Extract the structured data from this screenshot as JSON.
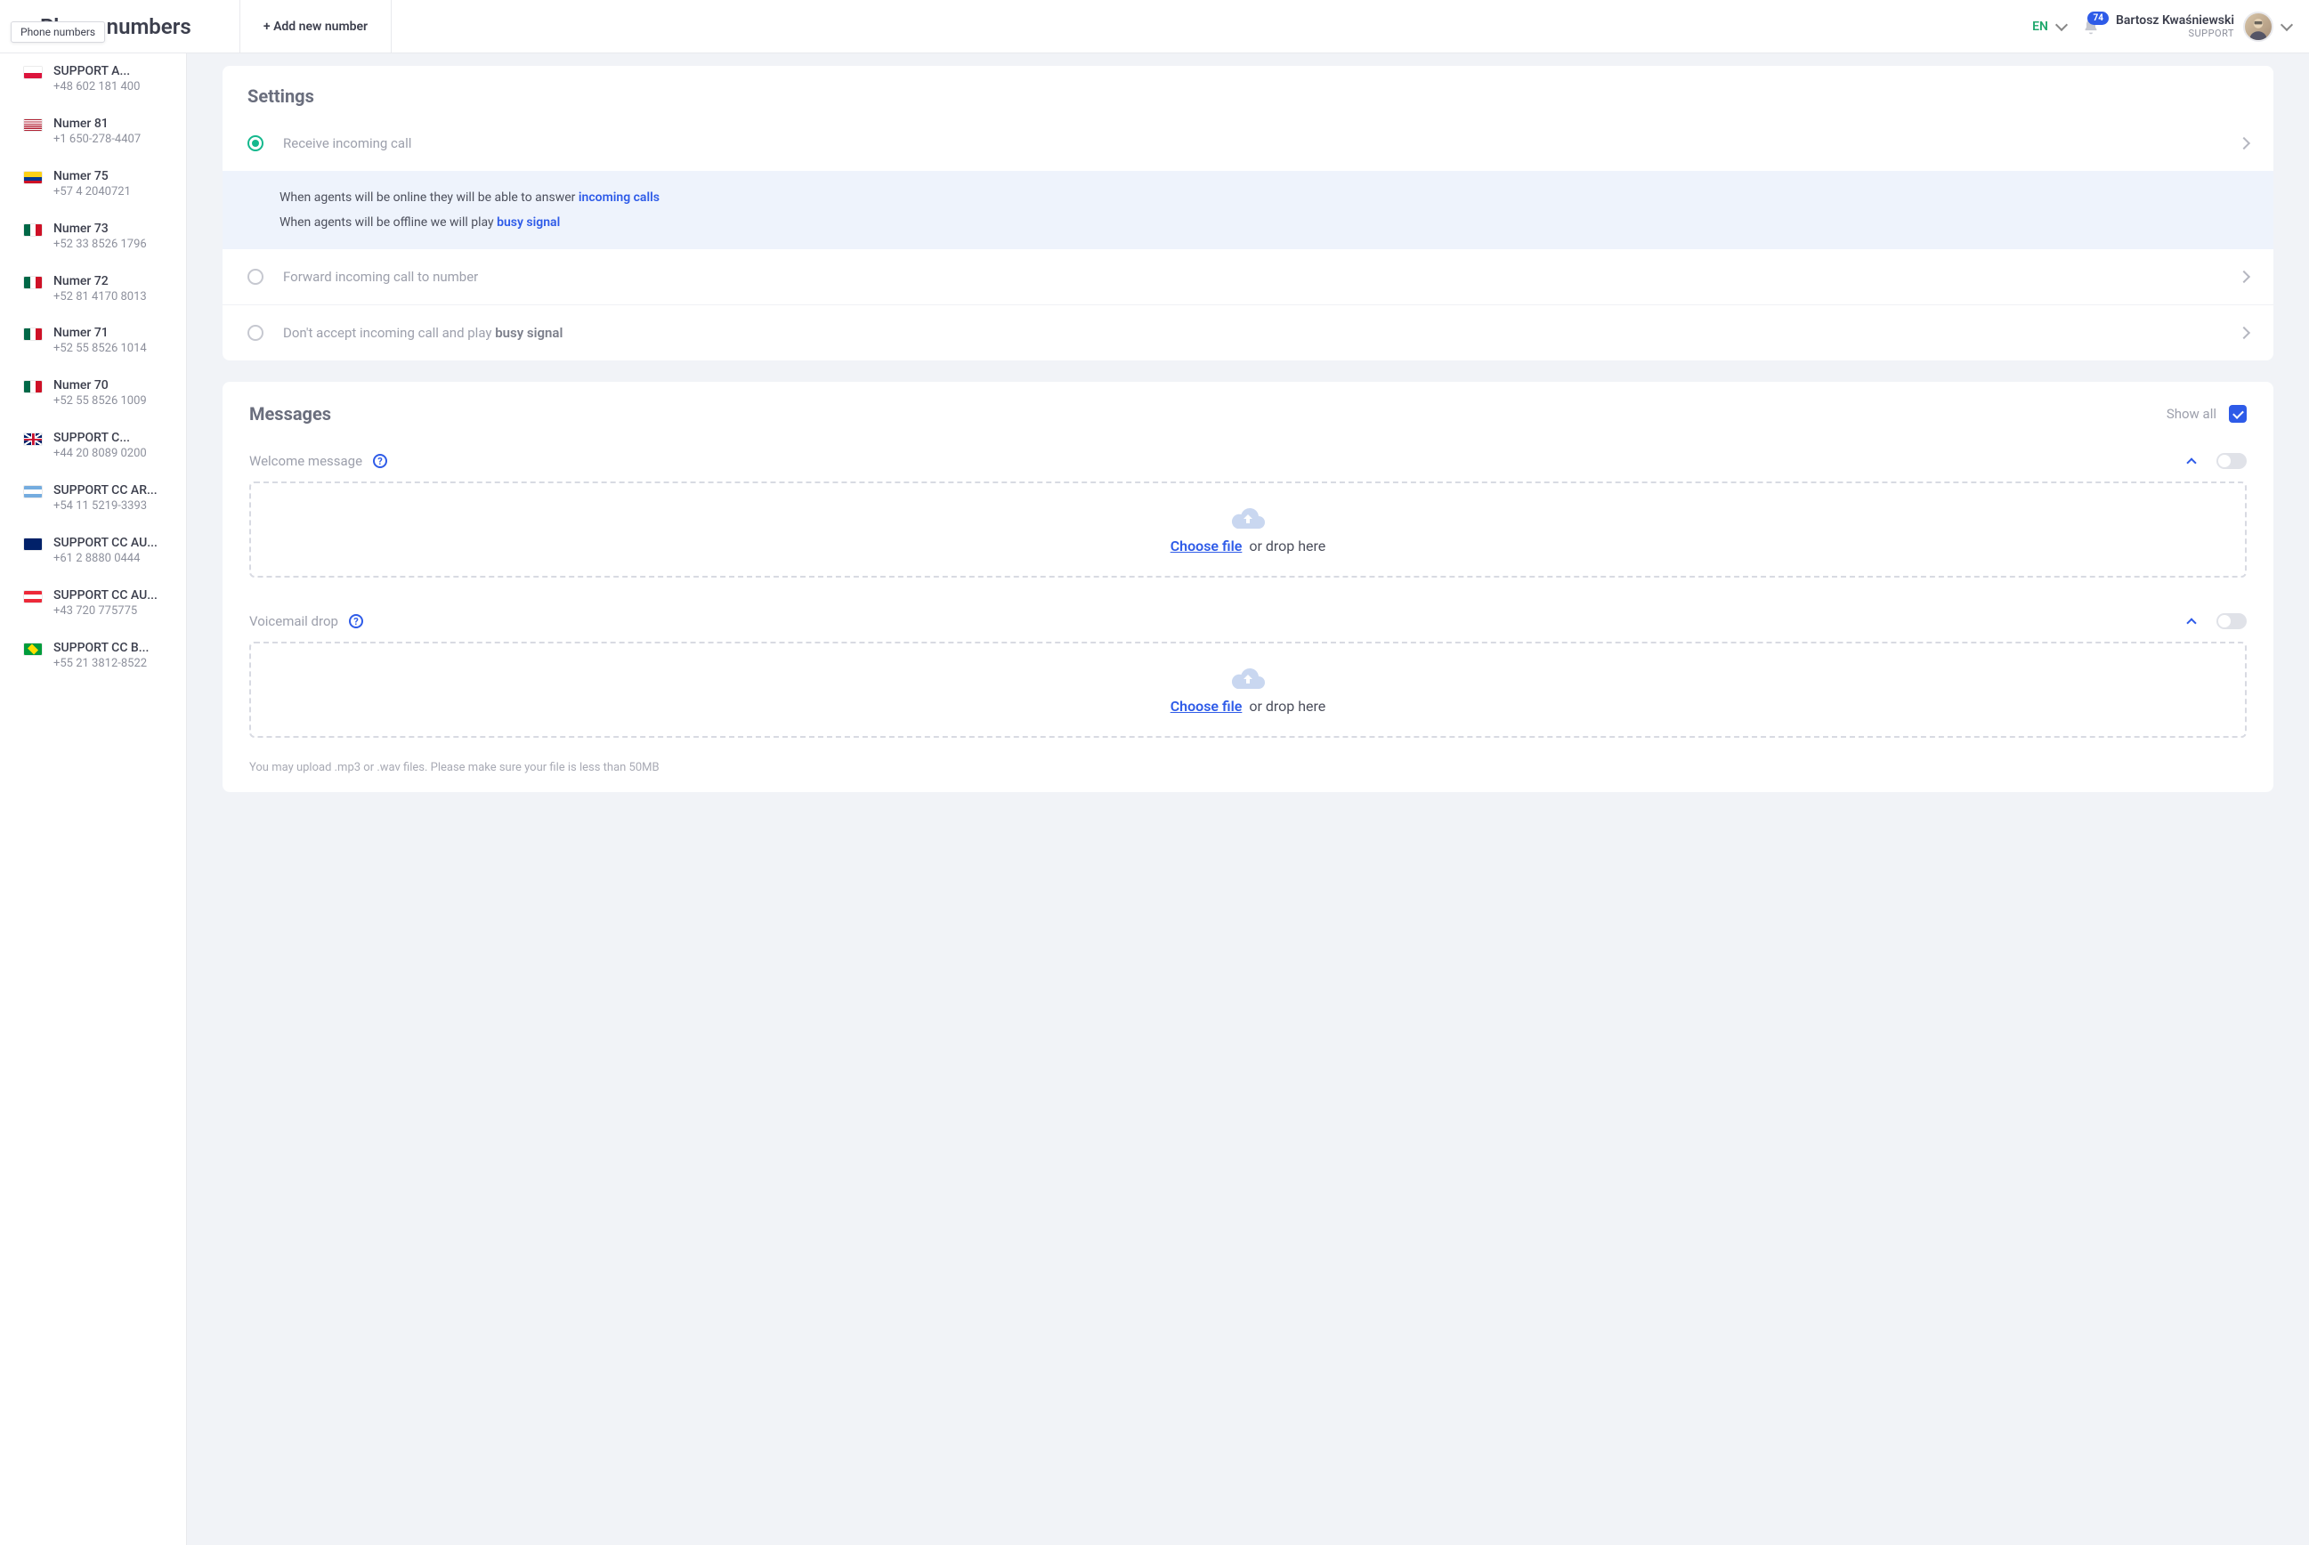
{
  "header": {
    "title": "Phone numbers",
    "tooltip": "Phone numbers",
    "add_button": "+ Add new number",
    "language": "EN",
    "notifications_count": "74",
    "user_name": "Bartosz Kwaśniewski",
    "user_role": "SUPPORT"
  },
  "sidebar": {
    "items": [
      {
        "name": "SUPPORT A...",
        "phone": "+48 602 181 400",
        "flag": "pl"
      },
      {
        "name": "Numer 81",
        "phone": "+1 650-278-4407",
        "flag": "us"
      },
      {
        "name": "Numer 75",
        "phone": "+57 4 2040721",
        "flag": "co"
      },
      {
        "name": "Numer 73",
        "phone": "+52 33 8526 1796",
        "flag": "mx"
      },
      {
        "name": "Numer 72",
        "phone": "+52 81 4170 8013",
        "flag": "mx"
      },
      {
        "name": "Numer 71",
        "phone": "+52 55 8526 1014",
        "flag": "mx"
      },
      {
        "name": "Numer 70",
        "phone": "+52 55 8526 1009",
        "flag": "mx"
      },
      {
        "name": "SUPPORT C...",
        "phone": "+44 20 8089 0200",
        "flag": "gb"
      },
      {
        "name": "SUPPORT CC AR...",
        "phone": "+54 11 5219-3393",
        "flag": "ar"
      },
      {
        "name": "SUPPORT CC AU...",
        "phone": "+61 2 8880 0444",
        "flag": "au"
      },
      {
        "name": "SUPPORT CC AU...",
        "phone": "+43 720 775775",
        "flag": "at"
      },
      {
        "name": "SUPPORT CC B...",
        "phone": "+55 21 3812-8522",
        "flag": "br"
      }
    ]
  },
  "settings": {
    "title": "Settings",
    "options": {
      "receive": "Receive incoming call",
      "forward": "Forward incoming call to number",
      "reject_prefix": "Don't accept incoming call and play ",
      "reject_bold": "busy signal"
    },
    "info_online_prefix": "When agents will be online they will be able to answer ",
    "info_online_link": "incoming calls",
    "info_offline_prefix": "When agents will be offline we will play ",
    "info_offline_link": "busy signal"
  },
  "messages": {
    "title": "Messages",
    "show_all": "Show all",
    "welcome_label": "Welcome message",
    "voicemail_label": "Voicemail drop",
    "choose_file": "Choose file",
    "or_drop": "or drop here",
    "help_glyph": "?",
    "upload_hint": "You may upload .mp3 or .wav files. Please make sure your file is less than 50MB"
  }
}
